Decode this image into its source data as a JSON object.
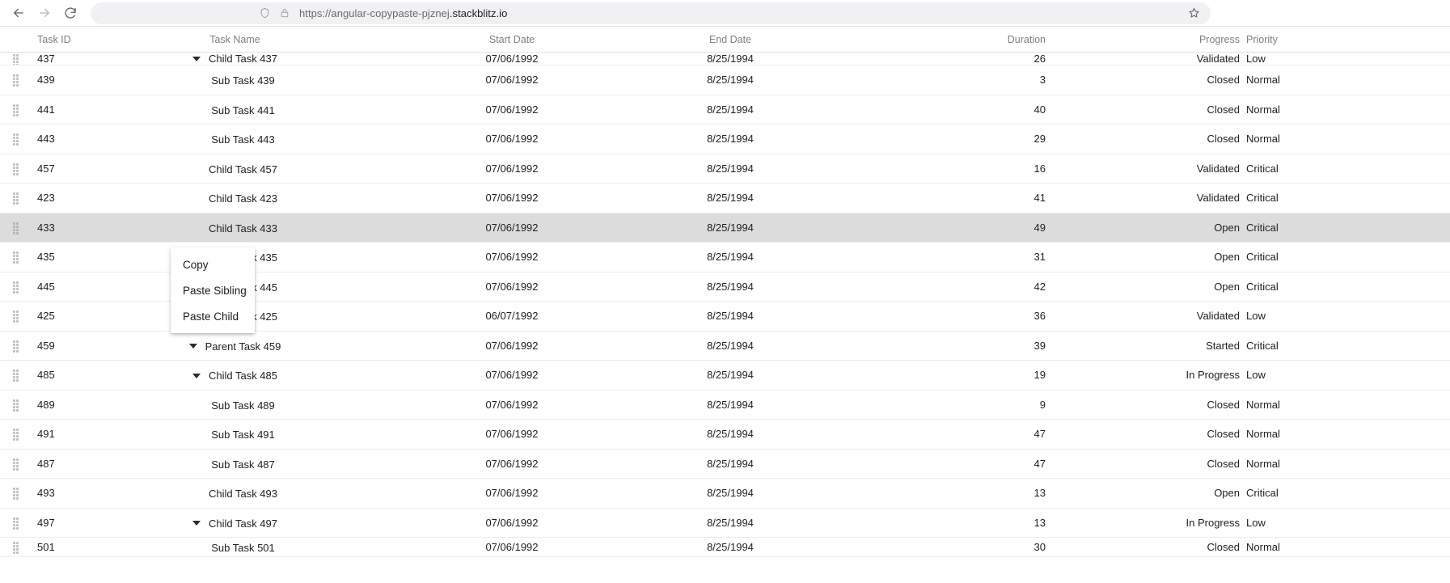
{
  "browser": {
    "back_label": "Back",
    "forward_label": "Forward",
    "reload_label": "Reload",
    "url_prefix": "https://angular-copypaste-pjznej",
    "url_host": ".stackblitz.io",
    "bookmark_label": "Bookmark this tab"
  },
  "grid": {
    "columns": [
      {
        "key": "handle",
        "label": ""
      },
      {
        "key": "id",
        "label": "Task ID"
      },
      {
        "key": "name",
        "label": "Task Name"
      },
      {
        "key": "start",
        "label": "Start Date"
      },
      {
        "key": "end",
        "label": "End Date"
      },
      {
        "key": "duration",
        "label": "Duration"
      },
      {
        "key": "progress",
        "label": "Progress"
      },
      {
        "key": "priority",
        "label": "Priority"
      }
    ],
    "rows": [
      {
        "id": "437",
        "name": "Child Task 437",
        "start": "07/06/1992",
        "end": "8/25/1994",
        "duration": "26",
        "progress": "Validated",
        "priority": "Low",
        "expander": true,
        "selected": false,
        "clip": "top"
      },
      {
        "id": "439",
        "name": "Sub Task 439",
        "start": "07/06/1992",
        "end": "8/25/1994",
        "duration": "3",
        "progress": "Closed",
        "priority": "Normal",
        "expander": false,
        "selected": false,
        "clip": ""
      },
      {
        "id": "441",
        "name": "Sub Task 441",
        "start": "07/06/1992",
        "end": "8/25/1994",
        "duration": "40",
        "progress": "Closed",
        "priority": "Normal",
        "expander": false,
        "selected": false,
        "clip": ""
      },
      {
        "id": "443",
        "name": "Sub Task 443",
        "start": "07/06/1992",
        "end": "8/25/1994",
        "duration": "29",
        "progress": "Closed",
        "priority": "Normal",
        "expander": false,
        "selected": false,
        "clip": ""
      },
      {
        "id": "457",
        "name": "Child Task 457",
        "start": "07/06/1992",
        "end": "8/25/1994",
        "duration": "16",
        "progress": "Validated",
        "priority": "Critical",
        "expander": false,
        "selected": false,
        "clip": ""
      },
      {
        "id": "423",
        "name": "Child Task 423",
        "start": "07/06/1992",
        "end": "8/25/1994",
        "duration": "41",
        "progress": "Validated",
        "priority": "Critical",
        "expander": false,
        "selected": false,
        "clip": ""
      },
      {
        "id": "433",
        "name": "Child Task 433",
        "start": "07/06/1992",
        "end": "8/25/1994",
        "duration": "49",
        "progress": "Open",
        "priority": "Critical",
        "expander": false,
        "selected": true,
        "clip": ""
      },
      {
        "id": "435",
        "name": "Child Task 435",
        "start": "07/06/1992",
        "end": "8/25/1994",
        "duration": "31",
        "progress": "Open",
        "priority": "Critical",
        "expander": false,
        "selected": false,
        "clip": ""
      },
      {
        "id": "445",
        "name": "Child Task 445",
        "start": "07/06/1992",
        "end": "8/25/1994",
        "duration": "42",
        "progress": "Open",
        "priority": "Critical",
        "expander": false,
        "selected": false,
        "clip": ""
      },
      {
        "id": "425",
        "name": "Child Task 425",
        "start": "06/07/1992",
        "end": "8/25/1994",
        "duration": "36",
        "progress": "Validated",
        "priority": "Low",
        "expander": false,
        "selected": false,
        "clip": ""
      },
      {
        "id": "459",
        "name": "Parent Task 459",
        "start": "07/06/1992",
        "end": "8/25/1994",
        "duration": "39",
        "progress": "Started",
        "priority": "Critical",
        "expander": true,
        "selected": false,
        "clip": ""
      },
      {
        "id": "485",
        "name": "Child Task 485",
        "start": "07/06/1992",
        "end": "8/25/1994",
        "duration": "19",
        "progress": "In Progress",
        "priority": "Low",
        "expander": true,
        "selected": false,
        "clip": ""
      },
      {
        "id": "489",
        "name": "Sub Task 489",
        "start": "07/06/1992",
        "end": "8/25/1994",
        "duration": "9",
        "progress": "Closed",
        "priority": "Normal",
        "expander": false,
        "selected": false,
        "clip": ""
      },
      {
        "id": "491",
        "name": "Sub Task 491",
        "start": "07/06/1992",
        "end": "8/25/1994",
        "duration": "47",
        "progress": "Closed",
        "priority": "Normal",
        "expander": false,
        "selected": false,
        "clip": ""
      },
      {
        "id": "487",
        "name": "Sub Task 487",
        "start": "07/06/1992",
        "end": "8/25/1994",
        "duration": "47",
        "progress": "Closed",
        "priority": "Normal",
        "expander": false,
        "selected": false,
        "clip": ""
      },
      {
        "id": "493",
        "name": "Child Task 493",
        "start": "07/06/1992",
        "end": "8/25/1994",
        "duration": "13",
        "progress": "Open",
        "priority": "Critical",
        "expander": false,
        "selected": false,
        "clip": ""
      },
      {
        "id": "497",
        "name": "Child Task 497",
        "start": "07/06/1992",
        "end": "8/25/1994",
        "duration": "13",
        "progress": "In Progress",
        "priority": "Low",
        "expander": true,
        "selected": false,
        "clip": ""
      },
      {
        "id": "501",
        "name": "Sub Task 501",
        "start": "07/06/1992",
        "end": "8/25/1994",
        "duration": "30",
        "progress": "Closed",
        "priority": "Normal",
        "expander": false,
        "selected": false,
        "clip": "bot"
      }
    ]
  },
  "context_menu": {
    "items": [
      {
        "label": "Copy"
      },
      {
        "label": "Paste Sibling"
      },
      {
        "label": "Paste Child"
      }
    ]
  },
  "colors": {
    "selected_row": "#dcdcdc",
    "header_text": "#7e7e86",
    "body_text": "#212121",
    "omnibox_bg": "#f1f1f4"
  }
}
